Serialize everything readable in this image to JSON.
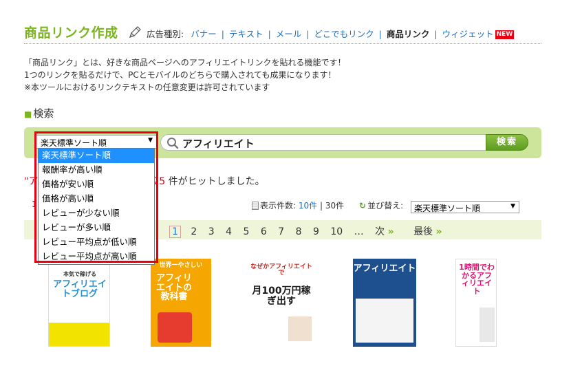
{
  "header": {
    "title": "商品リンク作成",
    "ad_type_label": "広告種別:",
    "nav": [
      {
        "label": "バナー",
        "current": false
      },
      {
        "label": "テキスト",
        "current": false
      },
      {
        "label": "メール",
        "current": false
      },
      {
        "label": "どこでもリンク",
        "current": false
      },
      {
        "label": "商品リンク",
        "current": true
      },
      {
        "label": "ウィジェット",
        "current": false
      }
    ],
    "new_badge": "NEW"
  },
  "description": [
    "「商品リンク」とは、好きな商品ページへのアフィリエイトリンクを貼れる機能です！",
    "1つのリンクを貼るだけで、PCとモバイルのどちらで購入されても成果になります！",
    "※本ツールにおけるリンクテキストの任意変更は許可されています"
  ],
  "search_section": {
    "title": "検索",
    "sort_selected": "楽天標準ソート順",
    "query": "アフィリエイト",
    "button": "検索",
    "sort_options": [
      "楽天標準ソート順",
      "報酬率が高い順",
      "価格が安い順",
      "価格が高い順",
      "レビューが少ない順",
      "レビューが多い順",
      "レビュー平均点が低い順",
      "レビュー平均点が高い順"
    ]
  },
  "results": {
    "kw_prefix": "\"ア",
    "count": "775",
    "suffix": "件がヒットしました。",
    "partial_number": "1",
    "display_label": "表示件数:",
    "display_10": "10件",
    "display_sep": "|",
    "display_30": "30件",
    "sort_label": "並び替え:",
    "sort_value": "楽天標準ソート順"
  },
  "pager": {
    "current": "1",
    "pages": [
      "2",
      "3",
      "4",
      "5",
      "6",
      "7",
      "8",
      "9",
      "10"
    ],
    "ellipsis": "…",
    "next": "次",
    "last": "最後",
    "chev": "»"
  },
  "books": [
    {
      "title": "アフィリエイトブログ",
      "sub": "本気で稼げる",
      "colors": {
        "bg": "#ffffff",
        "accent": "#2a8fd0",
        "band": "#f3e400"
      }
    },
    {
      "title": "アフィリエイトの教科書",
      "sub": "世界一やさしい",
      "colors": {
        "bg": "#f6a600",
        "accent": "#ffffff",
        "band": "#e63c2f"
      }
    },
    {
      "title": "月100万円稼ぎ出す",
      "sub": "なぜかアフィリエイトで",
      "colors": {
        "bg": "#ffffff",
        "accent": "#c8281e",
        "band": "#1b1b1b"
      }
    },
    {
      "title": "アフィリエイト",
      "sub": "",
      "colors": {
        "bg": "#1e4f8e",
        "accent": "#ffffff",
        "band": "#f4f4f4"
      }
    },
    {
      "title": "1時間でわかるアフィリエイト",
      "sub": "",
      "colors": {
        "bg": "#ffffff",
        "accent": "#d9166f",
        "band": "#e8e8e8"
      }
    }
  ]
}
